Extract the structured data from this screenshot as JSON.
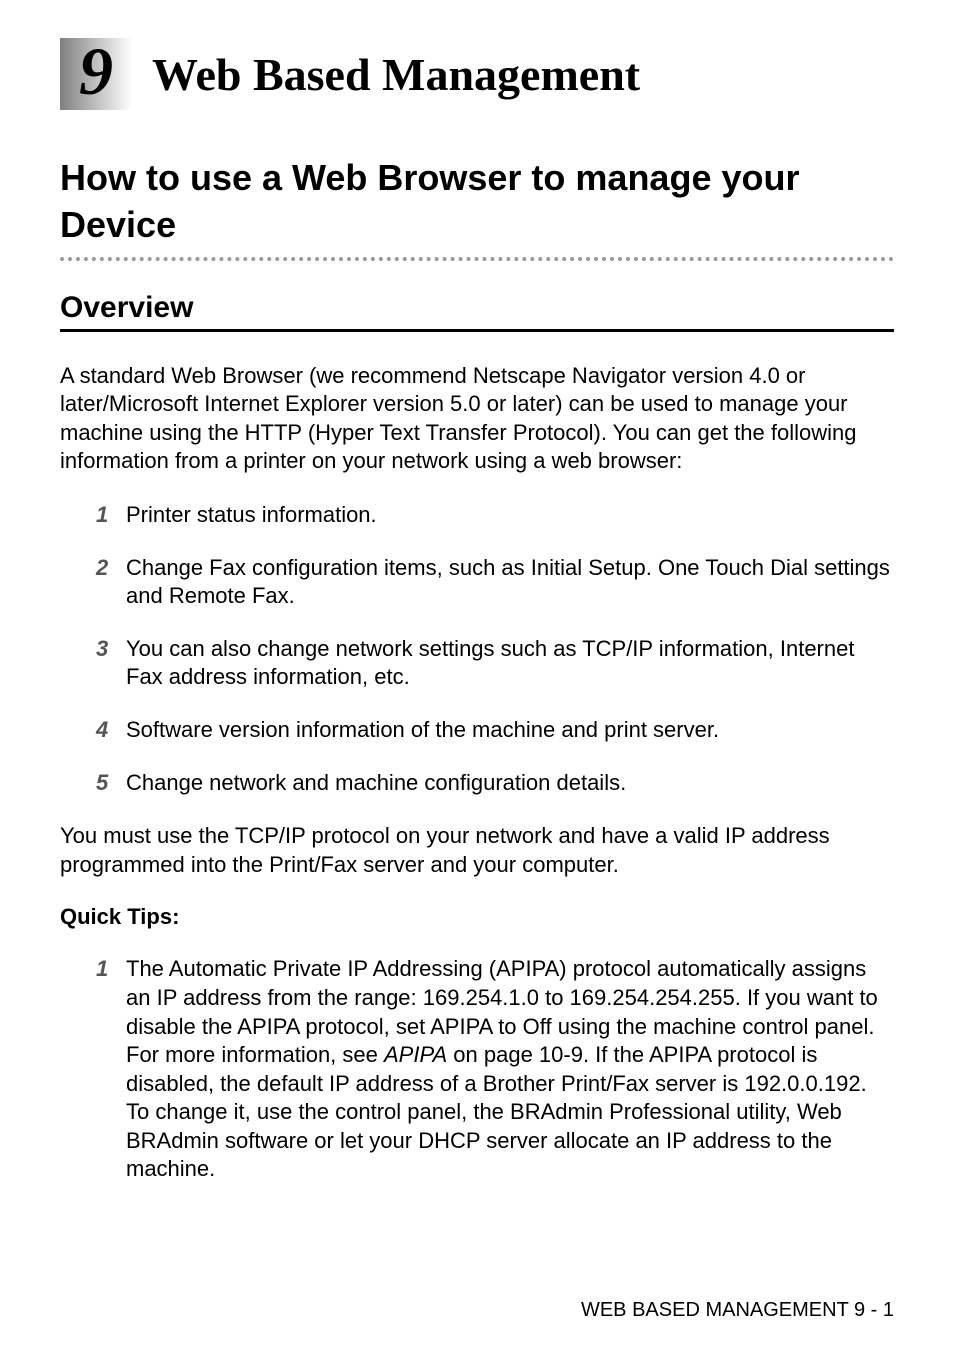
{
  "chapter": {
    "number": "9",
    "title": "Web Based Management"
  },
  "section": {
    "title": "How to use a Web Browser to manage your Device"
  },
  "subsection": {
    "title": "Overview"
  },
  "intro_paragraph": "A standard Web Browser (we recommend Netscape Navigator version 4.0 or later/Microsoft Internet Explorer version 5.0 or later) can be used to manage your machine using the HTTP (Hyper Text Transfer Protocol). You can get the following information from a printer on your network using a web browser:",
  "list1": [
    {
      "num": "1",
      "text": "Printer status information."
    },
    {
      "num": "2",
      "text": "Change Fax configuration items, such as Initial Setup. One Touch Dial settings and Remote Fax."
    },
    {
      "num": "3",
      "text": "You can also change network settings such as TCP/IP information, Internet Fax address information, etc."
    },
    {
      "num": "4",
      "text": "Software version information of the machine and print server."
    },
    {
      "num": "5",
      "text": "Change network and machine configuration details."
    }
  ],
  "requirement_paragraph": "You must use the TCP/IP protocol on your network and have a valid IP address programmed into the Print/Fax server and your computer.",
  "quick_tips_label": "Quick Tips:",
  "list2": [
    {
      "num": "1",
      "text_before_ref": "The Automatic Private IP Addressing (APIPA) protocol automatically assigns an IP address from the range: 169.254.1.0 to 169.254.254.255. If you want to disable the APIPA protocol, set APIPA to Off using the machine control panel. For more information, see ",
      "ref": "APIPA",
      "text_after_ref": " on page 10-9. If the APIPA protocol is disabled, the default IP address of a Brother Print/Fax server is 192.0.0.192. To change it, use the control panel, the BRAdmin Professional utility, Web BRAdmin software or let your DHCP server allocate an IP address to the machine."
    }
  ],
  "footer": "WEB BASED MANAGEMENT 9 - 1"
}
